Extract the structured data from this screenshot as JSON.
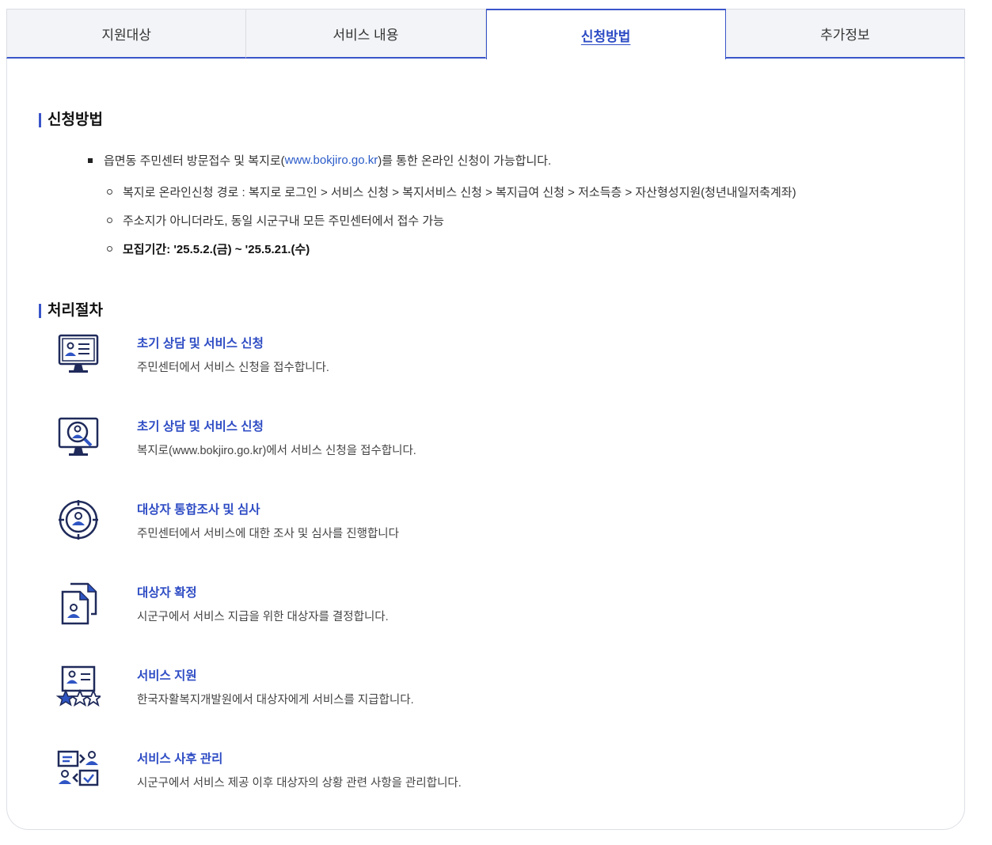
{
  "tabs": [
    {
      "label": "지원대상"
    },
    {
      "label": "서비스 내용"
    },
    {
      "label": "신청방법"
    },
    {
      "label": "추가정보"
    }
  ],
  "apply": {
    "title": "신청방법",
    "main_prefix": "읍면동 주민센터 방문접수 및 복지로(",
    "main_link": "www.bokjiro.go.kr",
    "main_suffix": ")를 통한 온라인 신청이 가능합니다.",
    "subs": [
      "복지로 온라인신청 경로 : 복지로 로그인 > 서비스 신청 > 복지서비스 신청 > 복지급여 신청 > 저소득층 > 자산형성지원(청년내일저축계좌)",
      "주소지가 아니더라도, 동일 시군구내 모든 주민센터에서 접수 가능",
      "모집기간: '25.5.2.(금) ~ '25.5.21.(수)"
    ]
  },
  "process": {
    "title": "처리절차",
    "steps": [
      {
        "icon": "monitor-profile-icon",
        "title": "초기 상담 및 서비스 신청",
        "desc": "주민센터에서 서비스 신청을 접수합니다."
      },
      {
        "icon": "monitor-search-user-icon",
        "title": "초기 상담 및 서비스 신청",
        "desc": "복지로(www.bokjiro.go.kr)에서 서비스 신청을 접수합니다."
      },
      {
        "icon": "target-user-icon",
        "title": "대상자 통합조사 및 심사",
        "desc": "주민센터에서 서비스에 대한 조사 및 심사를 진행합니다"
      },
      {
        "icon": "document-user-icon",
        "title": "대상자 확정",
        "desc": "시군구에서 서비스 지급을 위한 대상자를 결정합니다."
      },
      {
        "icon": "rating-card-icon",
        "title": "서비스 지원",
        "desc": "한국자활복지개발원에서 대상자에게 서비스를 지급합니다."
      },
      {
        "icon": "management-icon",
        "title": "서비스 사후 관리",
        "desc": "시군구에서 서비스 제공 이후 대상자의 상황 관련 사항을 관리합니다."
      }
    ]
  },
  "colors": {
    "accent": "#3a55c9",
    "icon_dark": "#1f2a5a",
    "icon_fill": "#2f55c4"
  }
}
